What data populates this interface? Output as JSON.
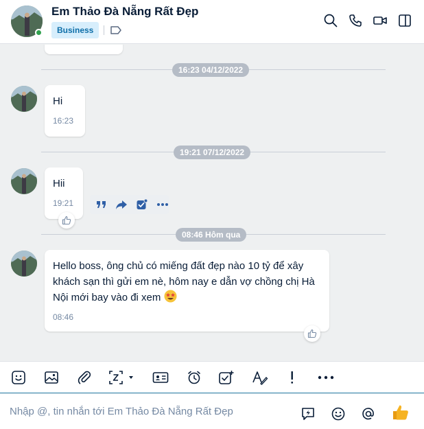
{
  "contact": {
    "name": "Em Thảo Đà Nẵng Rất Đẹp",
    "badge": "Business",
    "online": true
  },
  "header_icons": [
    "search-icon",
    "phone-icon",
    "video-call-icon",
    "toggle-sidebar-icon"
  ],
  "timestamps": [
    "16:23 04/12/2022",
    "19:21 07/12/2022",
    "08:46 Hôm qua"
  ],
  "messages": [
    {
      "text": "Hi",
      "time": "16:23"
    },
    {
      "text": "Hii",
      "time": "19:21"
    },
    {
      "text": "Hello boss, ông chủ có miếng đất đẹp nào 10 tỷ để xây khách sạn thì gửi em nè, hôm nay e dẫn vợ chồng chị Hà Nội mới bay vào đi xem",
      "time": "08:46",
      "emoji": "star-struck-emoji"
    }
  ],
  "message_actions": [
    "quote-icon",
    "forward-icon",
    "create-task-icon",
    "more-icon"
  ],
  "toolbar_icons": [
    "sticker-icon",
    "image-icon",
    "attachment-icon",
    "screenshot-icon",
    "contact-card-icon",
    "reminder-icon",
    "assign-task-icon",
    "text-format-icon",
    "urgent-icon",
    "more-icon"
  ],
  "composer": {
    "placeholder": "Nhập @, tin nhắn tới Em Thảo Đà Nẵng Rất Đẹp",
    "icons": [
      "quick-message-icon",
      "emoji-icon",
      "mention-icon",
      "thumbs-up-icon"
    ]
  },
  "colors": {
    "accent": "#0d6ea8",
    "badge_bg": "#d7eefc",
    "online": "#30a14e",
    "pill": "#b5bcc6",
    "like": "#f6b323"
  }
}
